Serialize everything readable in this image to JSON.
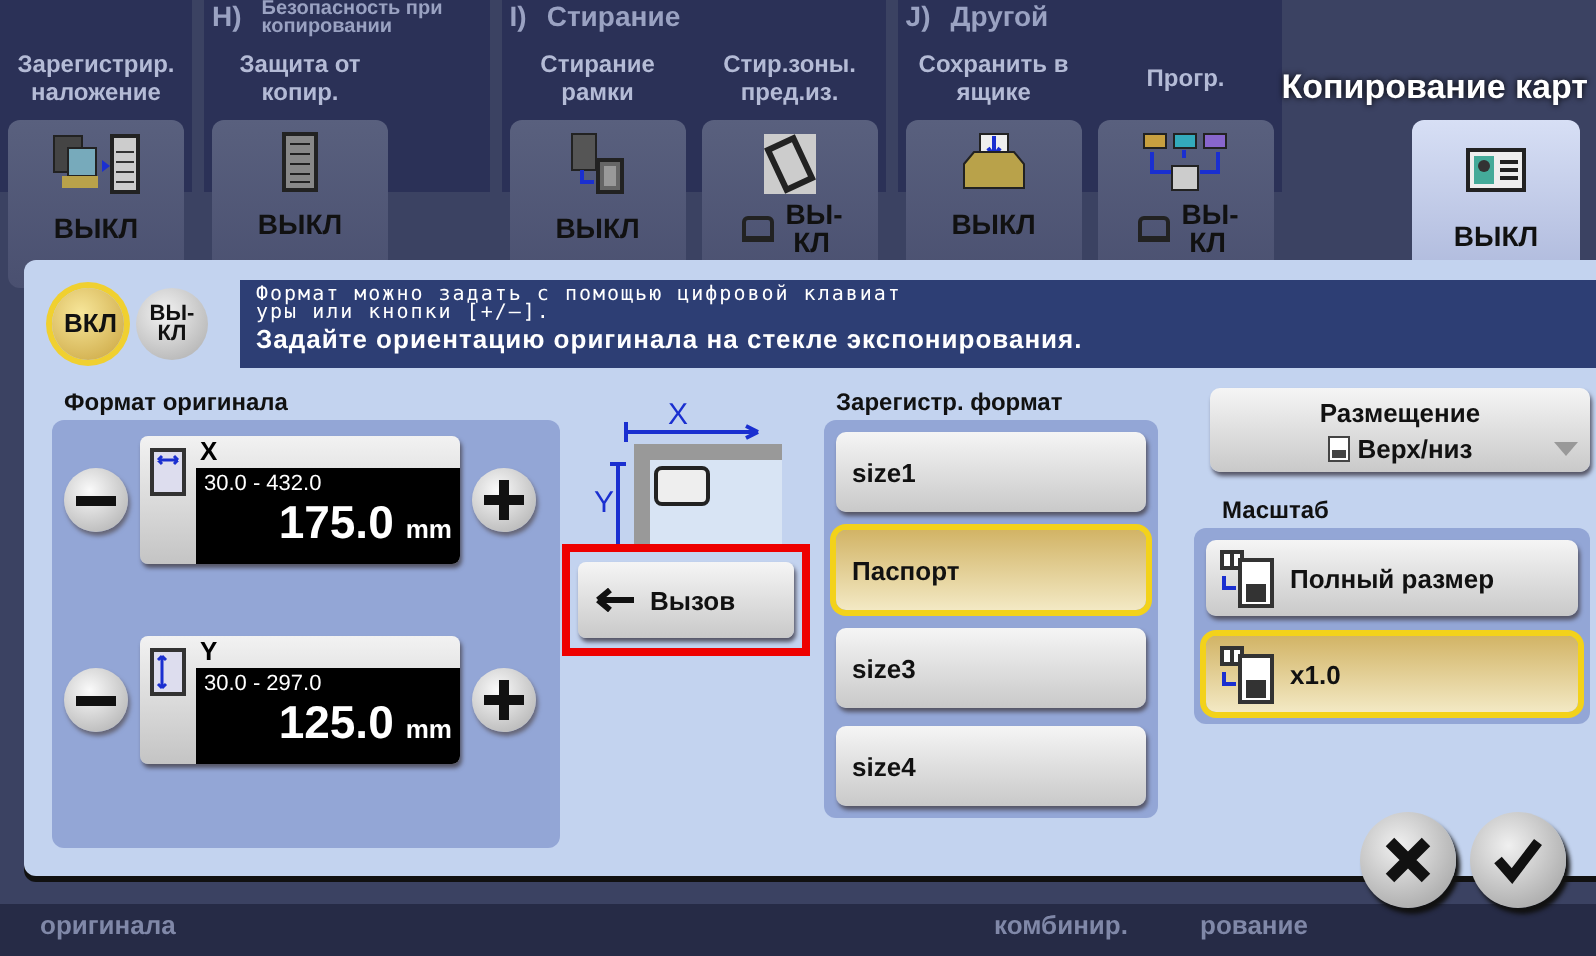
{
  "function_groups": [
    {
      "tiles": [
        {
          "label": "Зарегистрир. наложение",
          "value": "ВЫКЛ",
          "kind": "plain"
        }
      ]
    },
    {
      "letter": "H)",
      "name": "Безопасность при копировании",
      "tiles": [
        {
          "label": "Защита от копир.",
          "value": "ВЫКЛ",
          "kind": "plain"
        }
      ]
    },
    {
      "letter": "I)",
      "name": "Стирание",
      "tiles": [
        {
          "label": "Стирание рамки",
          "value": "ВЫКЛ",
          "kind": "plain"
        },
        {
          "label": "Стир.зоны. пред.из.",
          "value": "ВЫ-КЛ",
          "kind": "compact"
        }
      ]
    },
    {
      "letter": "J)",
      "name": "Другой",
      "tiles": [
        {
          "label": "Сохранить в ящике",
          "value": "ВЫКЛ",
          "kind": "plain"
        },
        {
          "label": "Прогр.",
          "value": "ВЫ-КЛ",
          "kind": "compact"
        }
      ]
    }
  ],
  "active_function": {
    "title": "Копирование карт",
    "value": "ВЫКЛ",
    "selected": true
  },
  "bottom_labels": [
    "оригинала",
    "комбинир.",
    "рование"
  ],
  "dialog": {
    "toggles": [
      {
        "label": "ВКЛ",
        "selected": true
      },
      {
        "label": "ВЫ-КЛ",
        "selected": false
      }
    ],
    "hint_lines": [
      "Формат можно задать с помощью цифровой клавиат",
      "уры или кнопки [+/–]."
    ],
    "instruction": "Задайте ориентацию оригинала на стекле экспонирования.",
    "original_size": {
      "title": "Формат оригинала",
      "fields": [
        {
          "axis": "X",
          "range": "30.0 - 432.0",
          "value": "175.0",
          "unit": "mm"
        },
        {
          "axis": "Y",
          "range": "30.0 - 297.0",
          "value": "125.0",
          "unit": "mm"
        }
      ]
    },
    "diagram_labels": [
      "X",
      "Y"
    ],
    "recall_button": "Вызов",
    "registered_sizes": {
      "title": "Зарегистр. формат",
      "items": [
        {
          "label": "size1",
          "selected": false
        },
        {
          "label": "Паспорт",
          "selected": true
        },
        {
          "label": "size3",
          "selected": false
        },
        {
          "label": "size4",
          "selected": false
        }
      ]
    },
    "placement": {
      "label": "Размещение",
      "value": "Верх/низ"
    },
    "zoom": {
      "title": "Масштаб",
      "items": [
        {
          "label": "Полный размер",
          "selected": false
        },
        {
          "label": "x1.0",
          "selected": true
        }
      ]
    }
  }
}
